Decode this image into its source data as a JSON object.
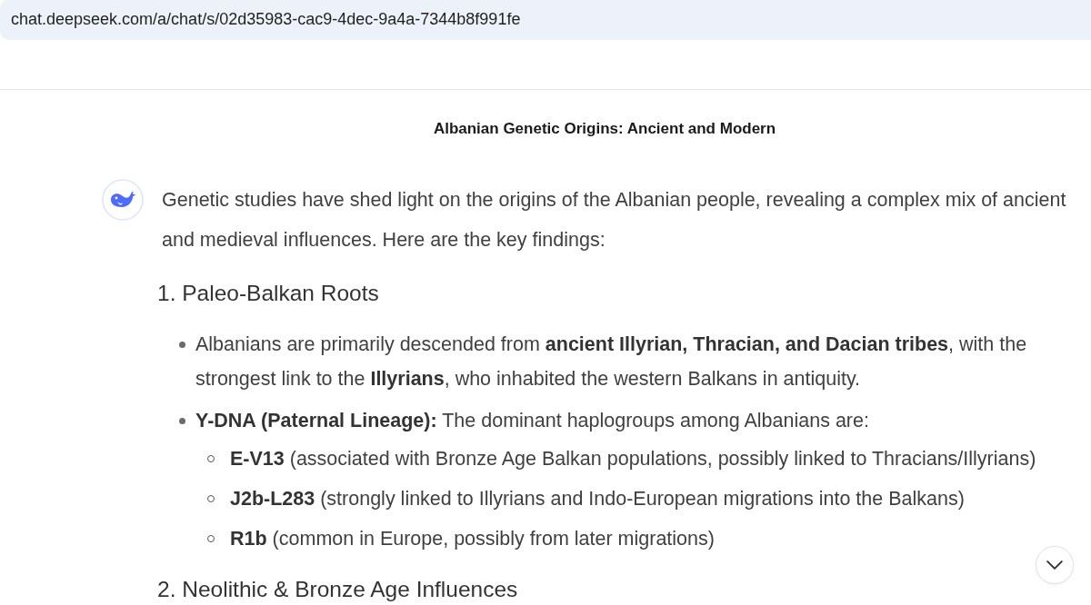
{
  "browser": {
    "url": "chat.deepseek.com/a/chat/s/02d35983-cac9-4dec-9a4a-7344b8f991fe"
  },
  "chat": {
    "title": "Albanian Genetic Origins: Ancient and Modern"
  },
  "message": {
    "intro": "Genetic studies have shed light on the origins of the Albanian people, revealing a complex mix of ancient and medieval influences. Here are the key findings:",
    "sections": [
      {
        "heading": "1. Paleo-Balkan Roots",
        "items": [
          {
            "text": "Albanians are primarily descended from **ancient Illyrian, Thracian, and Dacian tribes**, with the strongest link to the **Illyrians**, who inhabited the western Balkans in antiquity."
          },
          {
            "text": "**Y-DNA (Paternal Lineage):** The dominant haplogroups among Albanians are:",
            "children": [
              {
                "text": "**E-V13** (associated with Bronze Age Balkan populations, possibly linked to Thracians/Illyrians)"
              },
              {
                "text": "**J2b-L283** (strongly linked to Illyrians and Indo-European migrations into the Balkans)"
              },
              {
                "text": "**R1b** (common in Europe, possibly from later migrations)"
              }
            ]
          }
        ]
      },
      {
        "heading": "2. Neolithic & Bronze Age Influences"
      }
    ]
  }
}
